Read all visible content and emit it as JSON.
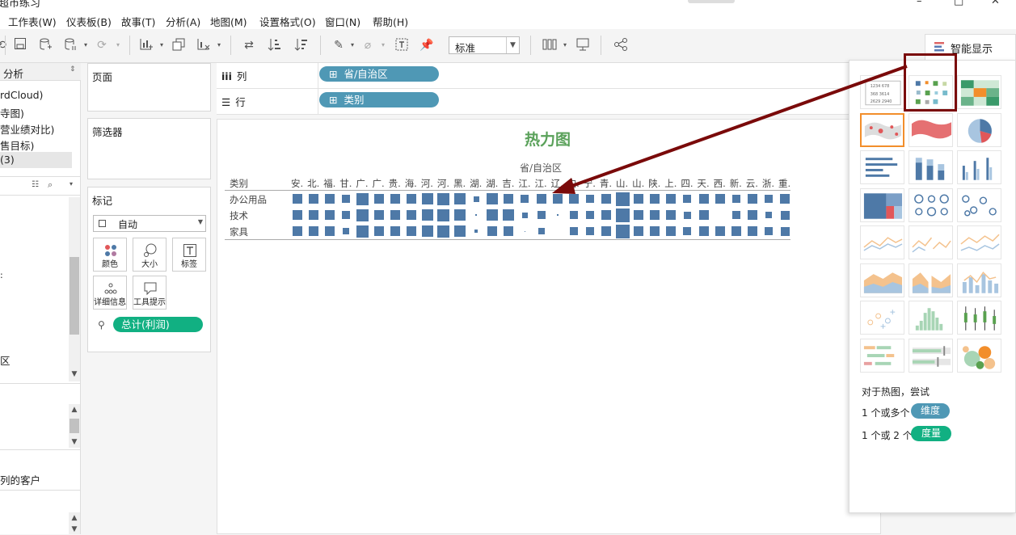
{
  "window": {
    "title": "超市练习"
  },
  "menu": [
    "工作表(W)",
    "仪表板(B)",
    "故事(T)",
    "分析(A)",
    "地图(M)",
    "设置格式(O)",
    "窗口(N)",
    "帮助(H)"
  ],
  "toolbar": {
    "fit_value": "标准",
    "smart_label": "智能显示"
  },
  "left_pane": {
    "header": "分析",
    "items": [
      "rdCloud)",
      "寺图)",
      "营业绩对比)",
      "售目标)",
      "(3)"
    ],
    "side_labels": [
      "区"
    ],
    "bottom_item": "列的客户"
  },
  "cards": {
    "pages": "页面",
    "filters": "筛选器",
    "marks": "标记"
  },
  "marks": {
    "type": "自动",
    "buttons": [
      "颜色",
      "大小",
      "标签",
      "详细信息",
      "工具提示"
    ],
    "field_pill": "总计(利润)"
  },
  "shelves": {
    "columns_label": "列",
    "columns_field": "省/自治区",
    "rows_label": "行",
    "rows_field": "类别"
  },
  "sheet": {
    "title": "热力图",
    "column_header": "省/自治区",
    "row_header": "类别",
    "column_labels": [
      "安.",
      "北.",
      "福.",
      "甘.",
      "广.",
      "广.",
      "贵.",
      "海.",
      "河.",
      "河.",
      "黑.",
      "湖.",
      "湖.",
      "吉.",
      "江.",
      "江.",
      "辽.",
      "内.",
      "宁.",
      "青.",
      "山.",
      "山.",
      "陕.",
      "上.",
      "四.",
      "天.",
      "西.",
      "新.",
      "云.",
      "浙.",
      "重."
    ],
    "rows": [
      "办公用品",
      "技术",
      "家具"
    ]
  },
  "chart_data": {
    "type": "heatmap",
    "title": "热力图",
    "xlabel": "省/自治区",
    "ylabel": "类别",
    "categories_x": [
      "安.",
      "北.",
      "福.",
      "甘.",
      "广.",
      "广.",
      "贵.",
      "海.",
      "河.",
      "河.",
      "黑.",
      "湖.",
      "湖.",
      "吉.",
      "江.",
      "江.",
      "辽.",
      "内.",
      "宁.",
      "青.",
      "山.",
      "山.",
      "陕.",
      "上.",
      "四.",
      "天.",
      "西.",
      "新.",
      "云.",
      "浙.",
      "重."
    ],
    "categories_y": [
      "办公用品",
      "技术",
      "家具"
    ],
    "size_values": [
      [
        12,
        12,
        12,
        10,
        15,
        12,
        12,
        12,
        14,
        15,
        14,
        7,
        14,
        12,
        10,
        12,
        12,
        12,
        10,
        12,
        17,
        12,
        12,
        12,
        10,
        12,
        12,
        10,
        12,
        10,
        12
      ],
      [
        12,
        12,
        12,
        10,
        15,
        12,
        12,
        12,
        14,
        15,
        14,
        2,
        14,
        14,
        7,
        10,
        2,
        10,
        10,
        12,
        17,
        12,
        12,
        12,
        9,
        12,
        0,
        10,
        12,
        8,
        11
      ],
      [
        12,
        12,
        12,
        8,
        15,
        12,
        12,
        12,
        14,
        15,
        14,
        4,
        12,
        12,
        1,
        8,
        0,
        10,
        10,
        12,
        17,
        12,
        12,
        12,
        10,
        12,
        12,
        12,
        12,
        10,
        11
      ]
    ],
    "mark_color": "#4e79a7",
    "legend": "none"
  },
  "smart_panel": {
    "hint_title": "对于热图，尝试",
    "hint_dim_prefix": "1 个或多个",
    "hint_dim_pill": "维度",
    "hint_measure_prefix": "1 个或 2 个",
    "hint_measure_pill": "度量",
    "thumb_icons": [
      "text-table",
      "heat-map",
      "highlight-table",
      "symbol-map",
      "filled-map",
      "pie-chart",
      "horizontal-bars",
      "stacked-bars",
      "side-by-side-bars",
      "treemap",
      "circle-views",
      "side-by-side-circles",
      "continuous-lines",
      "discrete-lines",
      "dual-lines",
      "area-continuous",
      "area-discrete",
      "dual-combination",
      "scatter-plot",
      "histogram",
      "box-whisker",
      "gantt",
      "bullet-graph",
      "packed-bubbles"
    ]
  },
  "colors": {
    "dimension_pill": "#4f98b5",
    "measure_pill": "#11b082",
    "highlight_box": "#7a0a0a",
    "title_green": "#5aa15a"
  }
}
